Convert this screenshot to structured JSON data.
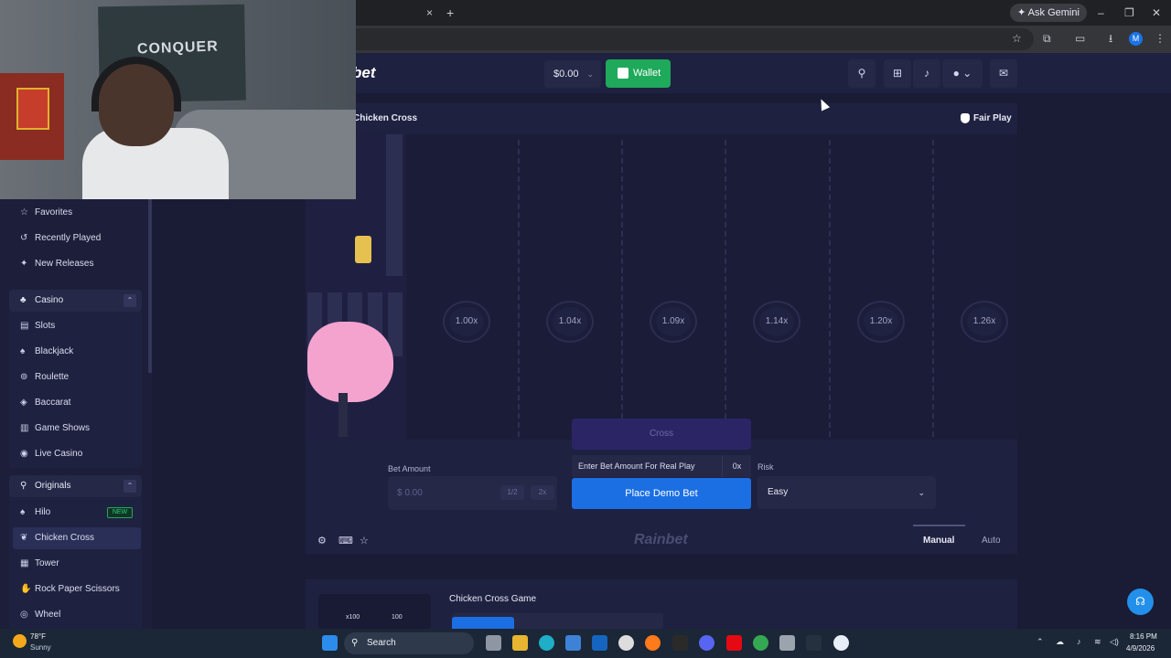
{
  "browser": {
    "gemini_label": "Ask Gemini",
    "profile_initial": "M",
    "new_tab_icon": "+",
    "close_tab_icon": "×"
  },
  "header": {
    "logo": "bet",
    "balance": "$0.00",
    "wallet_label": "Wallet"
  },
  "sidebar": {
    "items_top": [
      {
        "label": "Favorites",
        "icon": "star-icon"
      },
      {
        "label": "Recently Played",
        "icon": "history-icon"
      },
      {
        "label": "New Releases",
        "icon": "sparkle-icon"
      }
    ],
    "casino": {
      "label": "Casino",
      "items": [
        "Slots",
        "Blackjack",
        "Roulette",
        "Baccarat",
        "Game Shows",
        "Live Casino"
      ]
    },
    "originals": {
      "label": "Originals",
      "items": [
        "Hilo",
        "Chicken Cross",
        "Tower",
        "Rock Paper Scissors",
        "Wheel"
      ],
      "new_badge": "NEW",
      "active": "Chicken Cross"
    }
  },
  "game": {
    "title": "Chicken Cross",
    "fair_play": "Fair Play",
    "multipliers": [
      "1.00x",
      "1.04x",
      "1.09x",
      "1.14x",
      "1.20x",
      "1.26x"
    ],
    "cross_label": "Cross",
    "enter_bet": "Enter Bet Amount For Real Play",
    "enter_bet_multiplier": "0x",
    "place_demo": "Place Demo Bet",
    "bet_amount_label": "Bet Amount",
    "bet_placeholder": "$ 0.00",
    "half_label": "1/2",
    "double_label": "2x",
    "risk_label": "Risk",
    "risk_value": "Easy",
    "brand_mark": "Rainbet",
    "tab_manual": "Manual",
    "tab_auto": "Auto"
  },
  "info": {
    "title": "Chicken Cross Game",
    "thumb_label_1": "x100",
    "thumb_label_2": "100"
  },
  "webcam": {
    "banner_text": "CONQUER"
  },
  "taskbar": {
    "weather_temp": "78°F",
    "weather_desc": "Sunny",
    "search_label": "Search",
    "time": "8:16 PM",
    "date": "4/9/2026"
  }
}
